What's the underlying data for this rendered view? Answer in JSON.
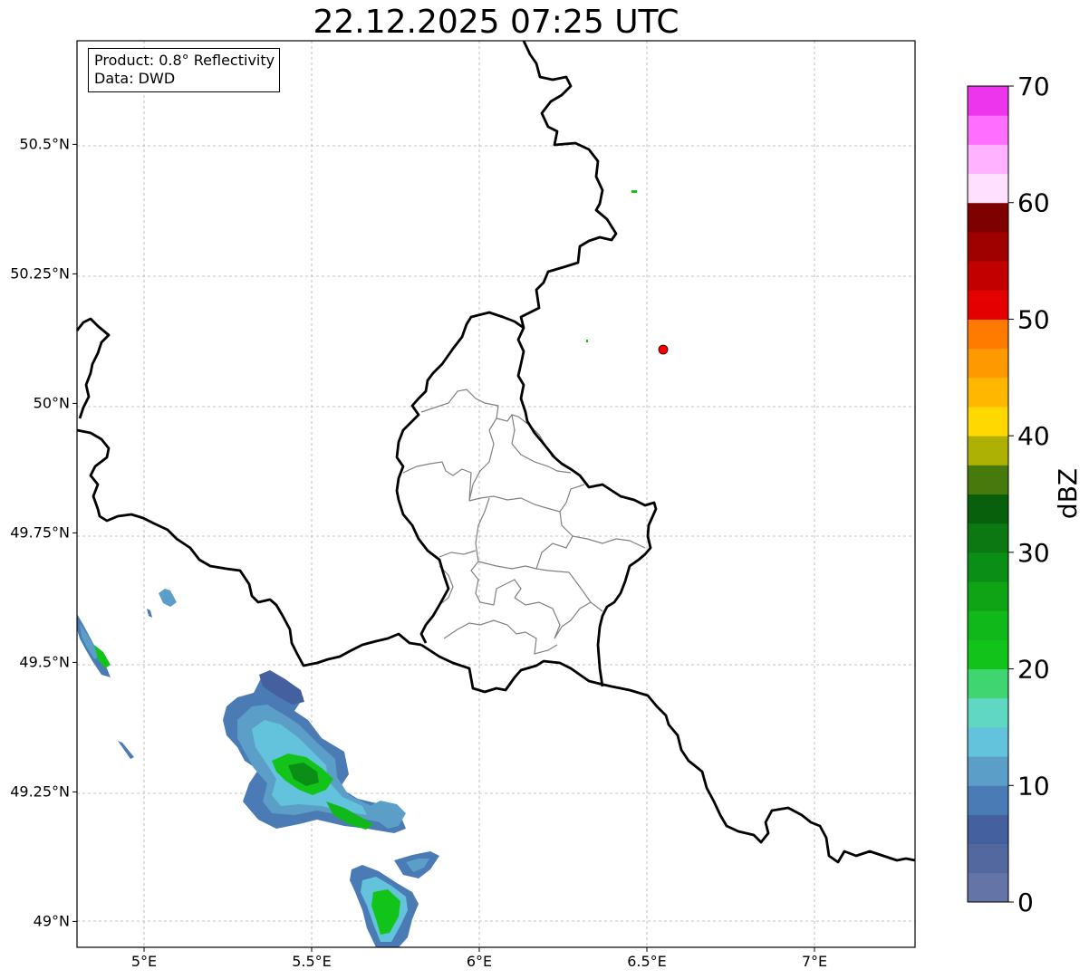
{
  "title": "22.12.2025 07:25 UTC",
  "info": {
    "product_line": "Product: 0.8° Reflectivity",
    "data_line": "Data: DWD"
  },
  "map": {
    "lon_range": [
      4.8,
      7.3
    ],
    "lat_range": [
      48.95,
      50.7
    ],
    "lon_ticks": [
      {
        "value": 5.0,
        "label": "5°E"
      },
      {
        "value": 5.5,
        "label": "5.5°E"
      },
      {
        "value": 6.0,
        "label": "6°E"
      },
      {
        "value": 6.5,
        "label": "6.5°E"
      },
      {
        "value": 7.0,
        "label": "7°E"
      }
    ],
    "lat_ticks": [
      {
        "value": 49.0,
        "label": "49°N"
      },
      {
        "value": 49.25,
        "label": "49.25°N"
      },
      {
        "value": 49.5,
        "label": "49.5°N"
      },
      {
        "value": 49.75,
        "label": "49.75°N"
      },
      {
        "value": 50.0,
        "label": "50°N"
      },
      {
        "value": 50.25,
        "label": "50.25°N"
      },
      {
        "value": 50.5,
        "label": "50.5°N"
      }
    ],
    "gridlines": true,
    "marker": {
      "lon": 6.55,
      "lat": 50.11,
      "color": "#ff0000"
    }
  },
  "colorbar": {
    "label": "dBZ",
    "min": 0,
    "max": 70,
    "step": 2.5,
    "tick_values": [
      0,
      10,
      20,
      30,
      40,
      50,
      60,
      70
    ],
    "tick_labels": [
      "0",
      "10",
      "20",
      "30",
      "40",
      "50",
      "60",
      "70"
    ],
    "colors": [
      "#6474a6",
      "#5468a0",
      "#44609f",
      "#4a7bb4",
      "#5b9fc8",
      "#63c3dc",
      "#5fd7c2",
      "#3fd672",
      "#12c41a",
      "#11b81a",
      "#0fa416",
      "#0b8e15",
      "#0b7812",
      "#085f0c",
      "#47790d",
      "#adb104",
      "#ffd701",
      "#ffb700",
      "#ff9900",
      "#ff7b00",
      "#e40000",
      "#c20000",
      "#9f0000",
      "#7f0000",
      "#ffe0ff",
      "#ffb2ff",
      "#ff6eff",
      "#ee35ee"
    ]
  }
}
